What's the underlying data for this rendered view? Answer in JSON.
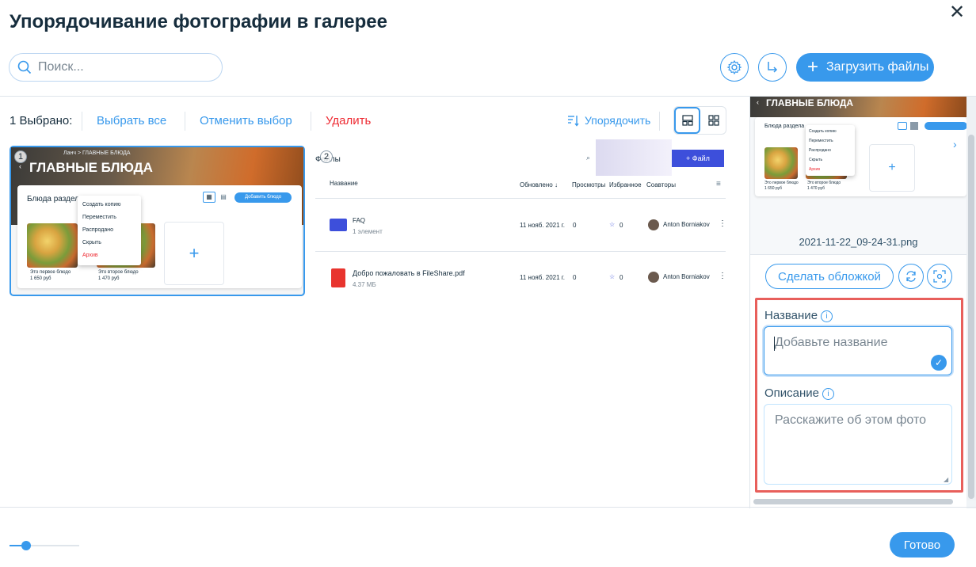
{
  "header": {
    "title": "Упорядочивание фотографии в галерее",
    "close_icon": "close-icon"
  },
  "search": {
    "placeholder": "Поиск..."
  },
  "actions": {
    "settings_icon": "gear-icon",
    "export_icon": "share-arrow-icon",
    "upload_label": "Загрузить файлы"
  },
  "toolbar": {
    "selected_count": "1 Выбрано:",
    "select_all": "Выбрать все",
    "deselect": "Отменить выбор",
    "delete": "Удалить",
    "sort": "Упорядочить"
  },
  "thumbnails": [
    {
      "badge": "1",
      "breadcrumb": "Ланч  >  ГЛАВНЫЕ БЛЮДА",
      "heading": "ГЛАВНЫЕ БЛЮДА",
      "section": "Блюда раздела",
      "add_button": "Добавить блюдо",
      "menu": [
        "Создать копию",
        "Переместить",
        "Распродано",
        "Скрыть",
        "Архив"
      ],
      "items": [
        {
          "name": "Это первое блюдо",
          "price": "1 650 руб"
        },
        {
          "name": "Это второе блюдо",
          "price": "1 470 руб"
        }
      ]
    },
    {
      "badge": "2",
      "files_label": "Файлы",
      "add_file": "+ Файл",
      "columns": [
        "Название",
        "Обновлено ↓",
        "Просмотры",
        "Избранное",
        "Соавторы"
      ],
      "rows": [
        {
          "name": "FAQ",
          "meta": "1 элемент",
          "updated": "11 нояб. 2021 г.",
          "views": "0",
          "favorites": "0",
          "author": "Anton Borniakov"
        },
        {
          "name": "Добро пожаловать в FileShare.pdf",
          "meta": "4.37 МБ",
          "updated": "11 нояб. 2021 г.",
          "views": "0",
          "favorites": "0",
          "author": "Anton Borniakov"
        }
      ]
    }
  ],
  "panel": {
    "preview_heading": "ГЛАВНЫЕ БЛЮДА",
    "preview_section": "Блюда раздела",
    "preview_menu": [
      "Создать копию",
      "Переместить",
      "Распродано",
      "Скрыть",
      "Архив"
    ],
    "preview_items": [
      {
        "name": "Это первое блюдо",
        "price": "1 650 руб"
      },
      {
        "name": "Это второе блюдо",
        "price": "1 470 руб"
      }
    ],
    "filename": "2021-11-22_09-24-31.png",
    "cover_button": "Сделать обложкой",
    "name_label": "Название",
    "name_placeholder": "Добавьте название",
    "description_label": "Описание",
    "description_placeholder": "Расскажите об этом фото"
  },
  "footer": {
    "zoom_level": 0.25,
    "done_label": "Готово"
  },
  "colors": {
    "accent": "#3899ec",
    "danger": "#ee2a32",
    "highlight": "#e85f5b"
  }
}
